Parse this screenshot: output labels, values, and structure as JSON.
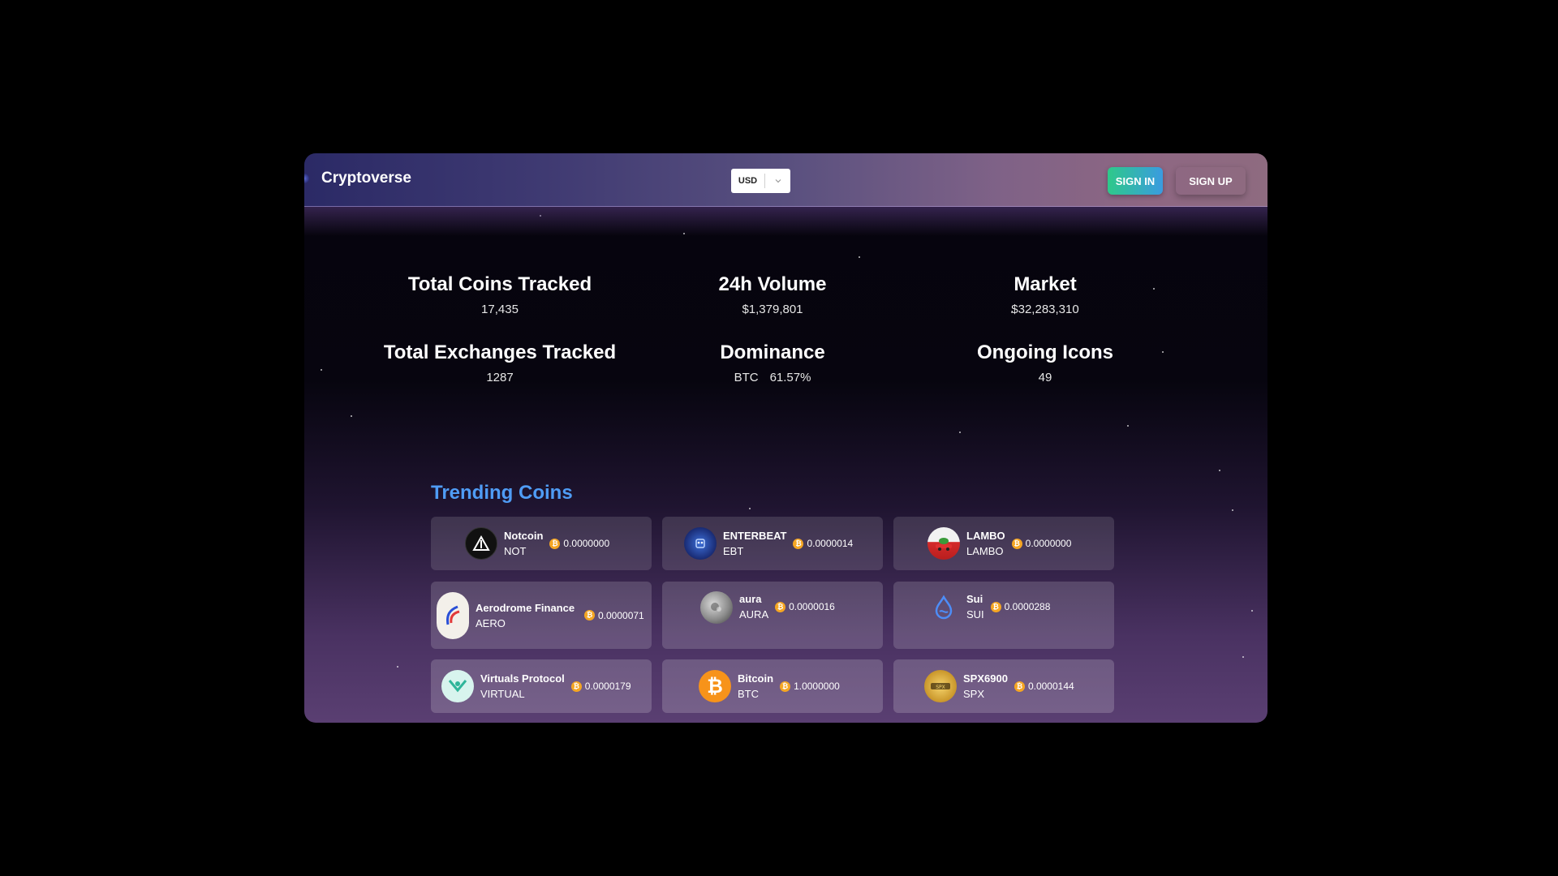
{
  "header": {
    "app_title": "Cryptoverse",
    "currency": {
      "selected": "USD"
    },
    "sign_in_label": "SIGN IN",
    "sign_up_label": "SIGN UP"
  },
  "stats": [
    {
      "title": "Total Coins Tracked",
      "value": "17,435"
    },
    {
      "title": "24h Volume",
      "value": "$1,379,801"
    },
    {
      "title": "Market",
      "value": "$32,283,310"
    },
    {
      "title": "Total Exchanges Tracked",
      "value": "1287"
    },
    {
      "title": "Dominance",
      "symbol": "BTC",
      "value": "61.57%"
    },
    {
      "title": "Ongoing Icons",
      "value": "49"
    }
  ],
  "trending": {
    "title": "Trending Coins",
    "coins": [
      {
        "name": "Notcoin",
        "symbol": "NOT",
        "price": "0.0000000",
        "icon": "notcoin-icon"
      },
      {
        "name": "ENTERBEAT",
        "symbol": "EBT",
        "price": "0.0000014",
        "icon": "enterbeat-icon"
      },
      {
        "name": "LAMBO",
        "symbol": "LAMBO",
        "price": "0.0000000",
        "icon": "lambo-icon"
      },
      {
        "name": "Aerodrome Finance",
        "symbol": "AERO",
        "price": "0.0000071",
        "icon": "aerodrome-icon"
      },
      {
        "name": "aura",
        "symbol": "AURA",
        "price": "0.0000016",
        "icon": "aura-icon"
      },
      {
        "name": "Sui",
        "symbol": "SUI",
        "price": "0.0000288",
        "icon": "sui-icon"
      },
      {
        "name": "Virtuals Protocol",
        "symbol": "VIRTUAL",
        "price": "0.0000179",
        "icon": "virtuals-icon"
      },
      {
        "name": "Bitcoin",
        "symbol": "BTC",
        "price": "1.0000000",
        "icon": "bitcoin-icon"
      },
      {
        "name": "SPX6900",
        "symbol": "SPX",
        "price": "0.0000144",
        "icon": "spx6900-icon"
      }
    ]
  },
  "colors": {
    "accent_blue": "#4f9cf5",
    "sign_in_gradient_start": "#2ec98a",
    "sign_in_gradient_end": "#3a9be0",
    "btc_orange": "#f5a623"
  }
}
